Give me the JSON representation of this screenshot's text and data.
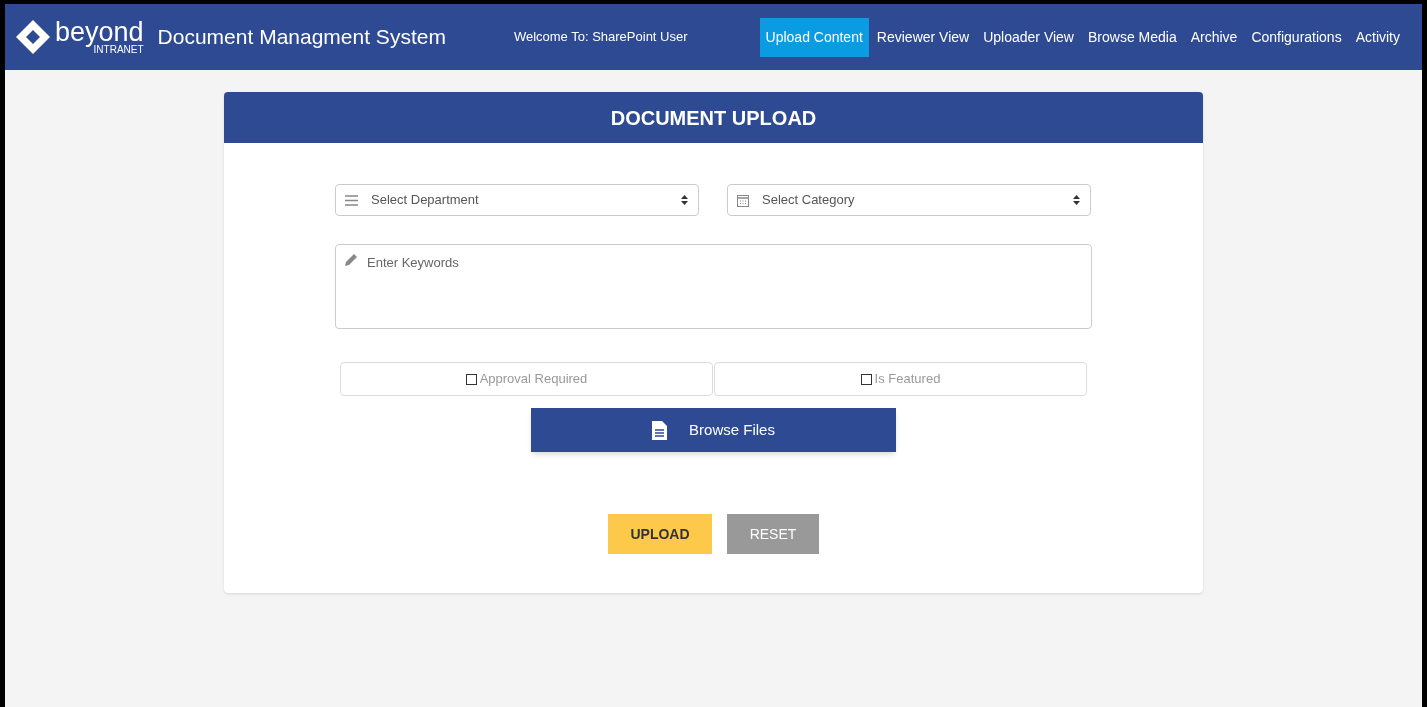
{
  "header": {
    "brand": "beyond",
    "brand_sub": "INTRANET",
    "title": "Document Managment System",
    "welcome": "Welcome To: SharePoint User"
  },
  "nav": [
    {
      "label": "Upload Content",
      "selected": true
    },
    {
      "label": "Reviewer View",
      "selected": false
    },
    {
      "label": "Uploader View",
      "selected": false
    },
    {
      "label": "Browse Media",
      "selected": false
    },
    {
      "label": "Archive",
      "selected": false
    },
    {
      "label": "Configurations",
      "selected": false
    },
    {
      "label": "Activity",
      "selected": false
    }
  ],
  "form": {
    "title": "DOCUMENT UPLOAD",
    "selects": [
      {
        "kind": "list",
        "placeholder": "Select Department"
      },
      {
        "kind": "calendar",
        "placeholder": "Select Category"
      }
    ],
    "keywords": {
      "placeholder": "Enter Keywords"
    },
    "checkboxes": [
      {
        "label": "Approval Required",
        "checked": false
      },
      {
        "label": "Is Featured",
        "checked": false
      }
    ],
    "browse_button": "Browse Files",
    "buttons": [
      {
        "kind": "primary",
        "label": "UPLOAD"
      },
      {
        "kind": "secondary",
        "label": "RESET"
      }
    ]
  }
}
